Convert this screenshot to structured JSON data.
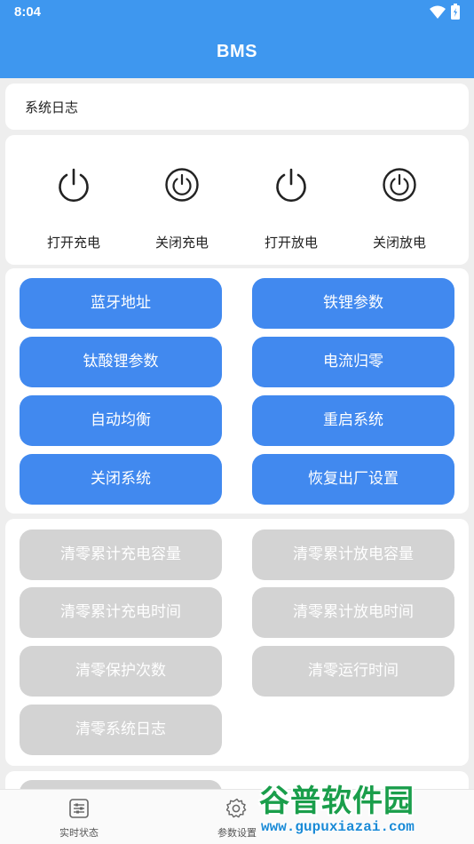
{
  "status_bar": {
    "time": "8:04"
  },
  "app_bar": {
    "title": "BMS"
  },
  "log": {
    "label": "系统日志"
  },
  "power_controls": [
    {
      "label": "打开充电",
      "icon": "power-icon"
    },
    {
      "label": "关闭充电",
      "icon": "power-circle-icon"
    },
    {
      "label": "打开放电",
      "icon": "power-icon"
    },
    {
      "label": "关闭放电",
      "icon": "power-circle-icon"
    }
  ],
  "blue_buttons": [
    "蓝牙地址",
    "铁锂参数",
    "钛酸锂参数",
    "电流归零",
    "自动均衡",
    "重启系统",
    "关闭系统",
    "恢复出厂设置"
  ],
  "gray_buttons": [
    "清零累计充电容量",
    "清零累计放电容量",
    "清零累计充电时间",
    "清零累计放电时间",
    "清零保护次数",
    "清零运行时间",
    "清零系统日志"
  ],
  "bottom_nav": [
    {
      "label": "实时状态",
      "icon": "sliders-icon"
    },
    {
      "label": "参数设置",
      "icon": "gear-icon"
    }
  ],
  "watermark": {
    "text": "谷普软件园",
    "url": "www.gupuxiazai.com"
  },
  "colors": {
    "primary": "#3e97ef",
    "button_blue": "#4189ef",
    "button_gray": "#d3d3d3"
  }
}
